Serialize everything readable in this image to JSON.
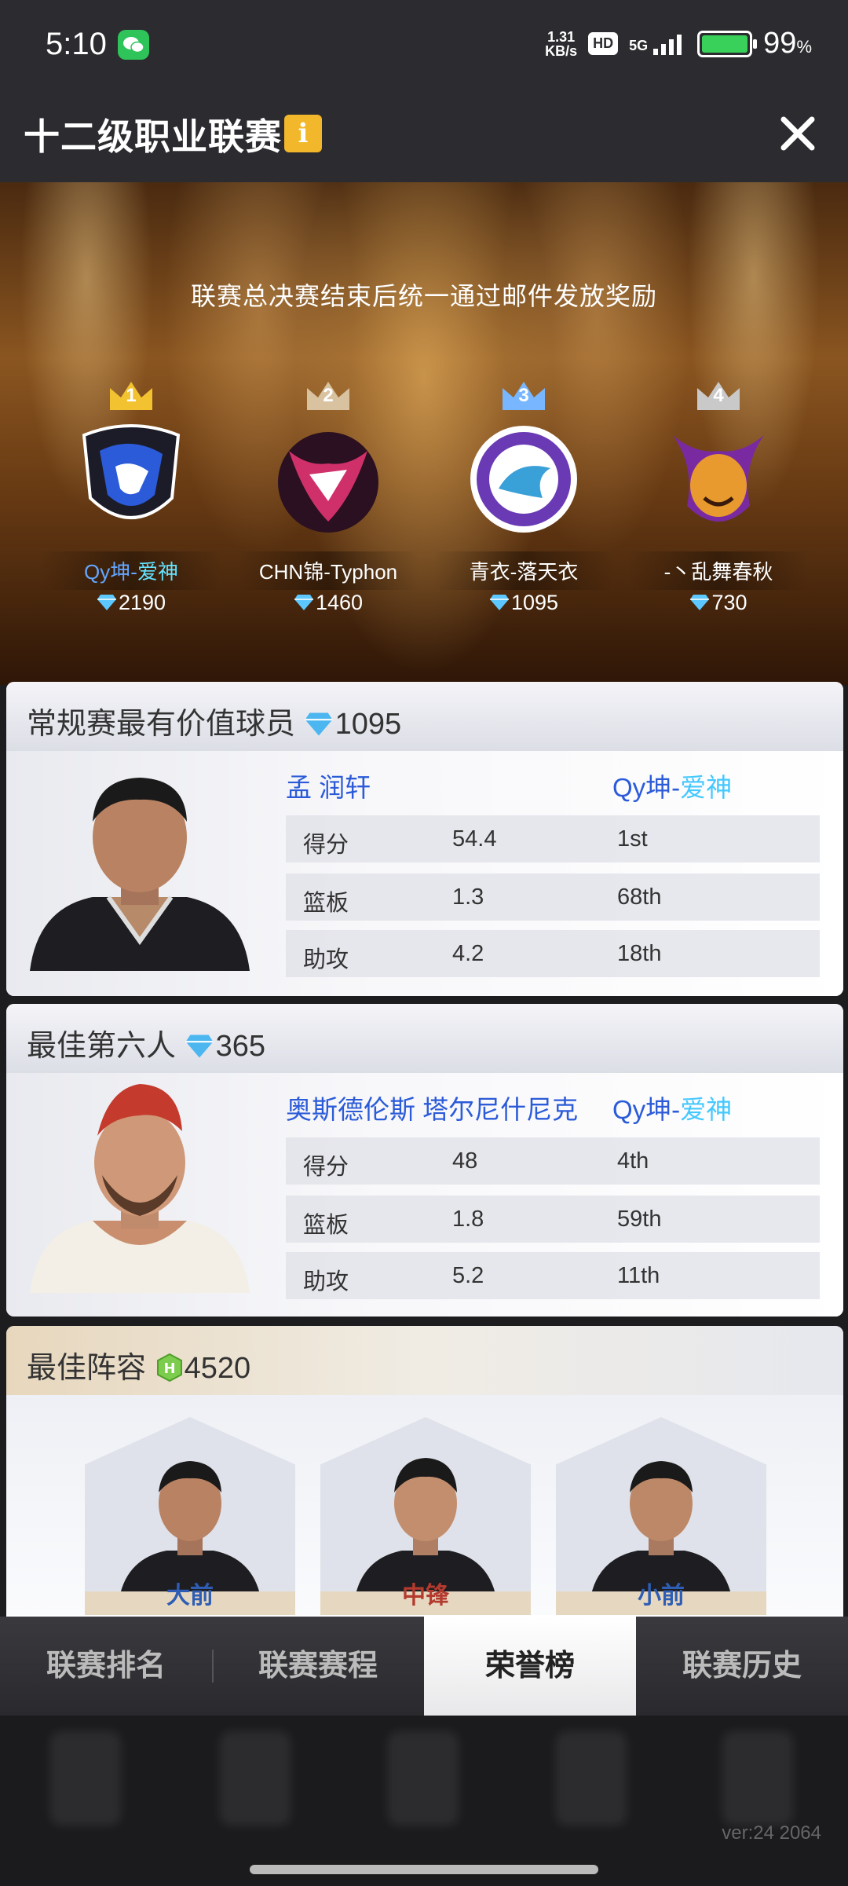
{
  "status_bar": {
    "time": "5:10",
    "speed_top": "1.31",
    "speed_bottom": "KB/s",
    "hd": "HD",
    "network": "5G",
    "battery": "99",
    "battery_unit": "%"
  },
  "header": {
    "title": "十二级职业联赛"
  },
  "stage": {
    "note": "联赛总决赛结束后统一通过邮件发放奖励",
    "teams": [
      {
        "rank": "1",
        "name_a": "Qy坤-",
        "name_b": "爱神",
        "gems": "2190",
        "crown_color": "#f2c230",
        "logo_color": "#2b5bd8"
      },
      {
        "rank": "2",
        "name_a": "CHN锦-Typhon",
        "name_b": "",
        "gems": "1460",
        "crown_color": "#d8c2a0",
        "logo_color": "#d0306a"
      },
      {
        "rank": "3",
        "name_a": "青衣-落天衣",
        "name_b": "",
        "gems": "1095",
        "crown_color": "#78b7ff",
        "logo_color": "#6a3ab5"
      },
      {
        "rank": "4",
        "name_a": "-丶乱舞春秋",
        "name_b": "",
        "gems": "730",
        "crown_color": "#c9c9c9",
        "logo_color": "#e89a2e"
      }
    ]
  },
  "mvp": {
    "title": "常规赛最有价值球员",
    "reward": "1095",
    "player": "孟 润轩",
    "team_a": "Qy坤-",
    "team_b": "爱神",
    "stats": [
      {
        "label": "得分",
        "value": "54.4",
        "rank": "1st"
      },
      {
        "label": "篮板",
        "value": "1.3",
        "rank": "68th"
      },
      {
        "label": "助攻",
        "value": "4.2",
        "rank": "18th"
      }
    ]
  },
  "sixth": {
    "title": "最佳第六人",
    "reward": "365",
    "player": "奥斯德伦斯 塔尔尼什尼克",
    "team_a": "Qy坤-",
    "team_b": "爱神",
    "stats": [
      {
        "label": "得分",
        "value": "48",
        "rank": "4th"
      },
      {
        "label": "篮板",
        "value": "1.8",
        "rank": "59th"
      },
      {
        "label": "助攻",
        "value": "5.2",
        "rank": "11th"
      }
    ]
  },
  "lineup": {
    "title": "最佳阵容",
    "reward": "4520",
    "slots": [
      {
        "label": "大前"
      },
      {
        "label": "中锋"
      },
      {
        "label": "小前"
      }
    ]
  },
  "tabs": [
    "联赛排名",
    "联赛赛程",
    "荣誉榜",
    "联赛历史"
  ],
  "active_tab": "荣誉榜",
  "footer": {
    "version": "ver:24  2064"
  }
}
